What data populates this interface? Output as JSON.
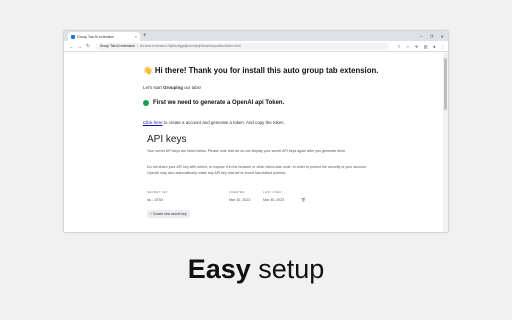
{
  "browser": {
    "tab_title": "Group Tab AI extension",
    "tab_close": "×",
    "new_tab": "+",
    "window_minimize": "–",
    "window_restore": "❐",
    "window_close": "✕",
    "nav_back": "←",
    "nav_forward": "→",
    "nav_reload": "↻",
    "omnibox_site": "Group Tab AI extension",
    "omnibox_separator": "|",
    "omnibox_url": "chrome-extension://kjlbendjgejkbomnjmj/html/donpolabs/index.html"
  },
  "page": {
    "greeting": "👋 Hi there! Thank you for install this auto group tab extension.",
    "start_prefix": "Let's start ",
    "start_bold": "Grouping",
    "start_suffix": " our tabs!",
    "step1": "First we need to generate a OpenAI api Token.",
    "instruction_link": "Click here",
    "instruction_rest": " to create a account and generate a token. And copy the token."
  },
  "api_keys_screenshot": {
    "title": "API keys",
    "paragraph1": "Your secret API keys are listed below. Please note that we do not display your secret API keys again after you generate them.",
    "paragraph2": "Do not share your API key with others, or expose it in the browser or other client-side code. In order to protect the security of your account, OpenAI may also automatically rotate any API key that we've found has leaked publicly.",
    "columns": [
      "SECRET KEY",
      "CREATED",
      "LAST USED"
    ],
    "rows": [
      {
        "key": "sk-...4T6X",
        "created": "Mar 30, 2023",
        "last_used": "Mar 30, 2023"
      }
    ],
    "create_button": "+ Create new secret key"
  },
  "tagline": {
    "bold": "Easy",
    "rest": " setup"
  },
  "colors": {
    "background": "#f1f1f1",
    "link": "#1a0dab",
    "status_green": "#1e9e4c"
  }
}
